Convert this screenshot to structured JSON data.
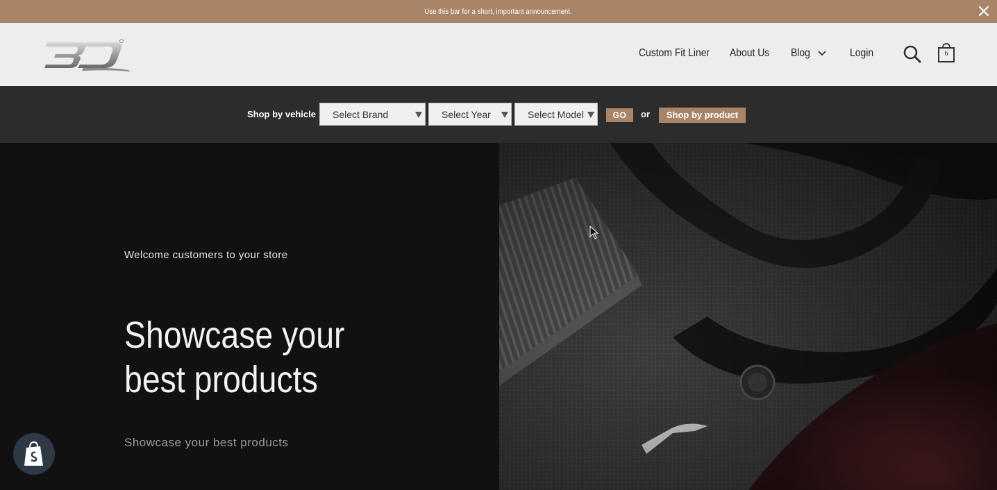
{
  "announcement": {
    "text": "Use this bar for a short, important announcement."
  },
  "header": {
    "nav": [
      {
        "label": "Custom Fit Liner"
      },
      {
        "label": "About Us"
      },
      {
        "label": "Blog"
      },
      {
        "label": "Login"
      }
    ],
    "cart_count": "6"
  },
  "shop_bar": {
    "label": "Shop by vehicle",
    "brand_select": "Select Brand",
    "year_select": "Select Year",
    "model_select": "Select Model",
    "go_label": "GO",
    "or_label": "or",
    "by_product_label": "Shop by product"
  },
  "hero": {
    "subheading": "Welcome customers to your store",
    "title": "Showcase your best products",
    "description": "Showcase your best products"
  },
  "colors": {
    "accent": "#a98466",
    "bar": "#2c2c2c",
    "header_bg": "#ededed",
    "hero_bg": "#111112"
  }
}
